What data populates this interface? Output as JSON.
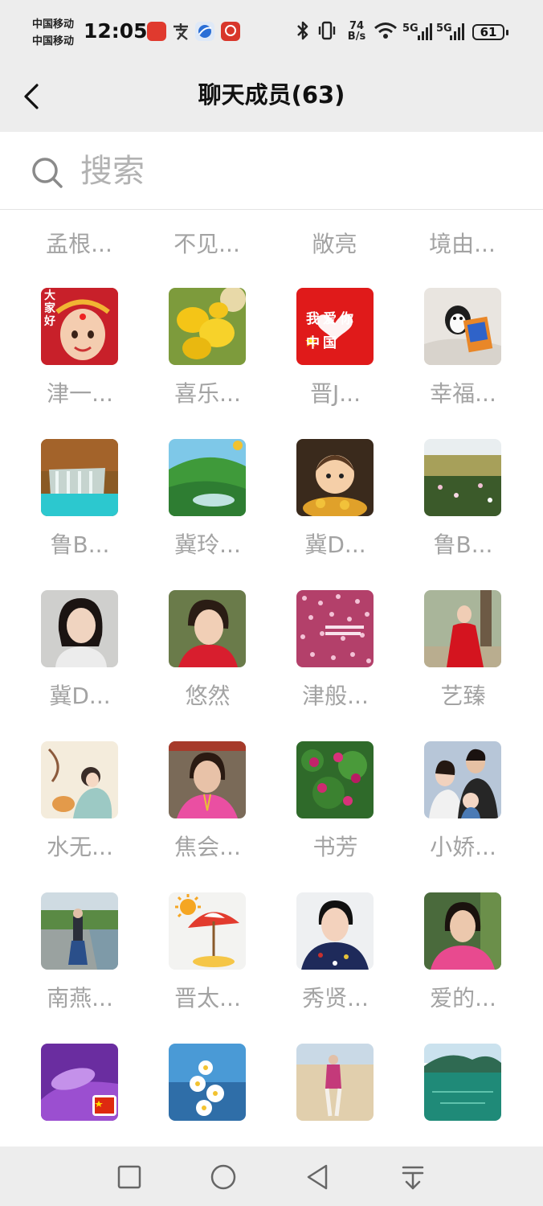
{
  "status_bar": {
    "carrier1": "中国移动",
    "carrier2": "中国移动",
    "time": "12:05",
    "speed_value": "74",
    "speed_unit": "B/s",
    "net1": "5G",
    "net2": "5G",
    "battery": "61"
  },
  "header": {
    "title": "聊天成员(63)"
  },
  "search": {
    "placeholder": "搜索"
  },
  "top_row_names": [
    "孟根...",
    "不见...",
    "敞亮",
    "境由..."
  ],
  "members": [
    {
      "name": "津一...",
      "icon": "girl-red-headdress-avatar",
      "avatar_text": "大家好"
    },
    {
      "name": "喜乐...",
      "icon": "yellow-flower-avatar"
    },
    {
      "name": "晋J...",
      "icon": "i-love-china-avatar",
      "avatar_text": "我爱你 中国"
    },
    {
      "name": "幸福...",
      "icon": "penguin-book-avatar"
    },
    {
      "name": "鲁B...",
      "icon": "waterfall-avatar"
    },
    {
      "name": "冀玲...",
      "icon": "green-valley-avatar"
    },
    {
      "name": "冀D...",
      "icon": "cartoon-child-gold-avatar"
    },
    {
      "name": "鲁B...",
      "icon": "flower-meadow-avatar"
    },
    {
      "name": "冀D...",
      "icon": "woman-portrait-avatar"
    },
    {
      "name": "悠然",
      "icon": "woman-red-scarf-avatar"
    },
    {
      "name": "津般...",
      "icon": "pink-polka-dot-avatar"
    },
    {
      "name": "艺臻",
      "icon": "woman-red-coat-avatar"
    },
    {
      "name": "水无...",
      "icon": "painting-girl-cat-avatar"
    },
    {
      "name": "焦会...",
      "icon": "woman-pink-shirt-avatar"
    },
    {
      "name": "书芳",
      "icon": "peony-bush-avatar"
    },
    {
      "name": "小娇...",
      "icon": "family-photo-avatar"
    },
    {
      "name": "南燕...",
      "icon": "lakeside-woman-avatar"
    },
    {
      "name": "晋太...",
      "icon": "beach-umbrella-avatar"
    },
    {
      "name": "秀贤...",
      "icon": "woman-floral-blouse-avatar"
    },
    {
      "name": "爱的...",
      "icon": "woman-pink-sweater-avatar"
    },
    {
      "name": "",
      "icon": "purple-flower-flag-avatar"
    },
    {
      "name": "",
      "icon": "daisies-lake-avatar"
    },
    {
      "name": "",
      "icon": "desert-woman-avatar"
    },
    {
      "name": "",
      "icon": "green-lake-avatar"
    }
  ],
  "colors": {
    "bar_background": "#ededed",
    "name_text": "#a3a3a3",
    "title_text": "#111111"
  }
}
